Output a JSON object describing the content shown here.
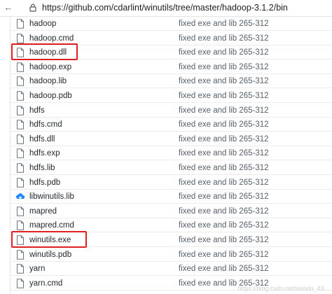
{
  "browser": {
    "url_host": "https://github.com",
    "url_path": "/cdarlint/winutils/tree/master/hadoop-3.1.2/bin"
  },
  "files": [
    {
      "name": "hadoop",
      "message": "fixed exe and lib 265-312",
      "icon": "file-icon",
      "highlighted": false
    },
    {
      "name": "hadoop.cmd",
      "message": "fixed exe and lib 265-312",
      "icon": "file-icon",
      "highlighted": false
    },
    {
      "name": "hadoop.dll",
      "message": "fixed exe and lib 265-312",
      "icon": "file-icon",
      "highlighted": true
    },
    {
      "name": "hadoop.exp",
      "message": "fixed exe and lib 265-312",
      "icon": "file-icon",
      "highlighted": false
    },
    {
      "name": "hadoop.lib",
      "message": "fixed exe and lib 265-312",
      "icon": "file-icon",
      "highlighted": false
    },
    {
      "name": "hadoop.pdb",
      "message": "fixed exe and lib 265-312",
      "icon": "file-icon",
      "highlighted": false
    },
    {
      "name": "hdfs",
      "message": "fixed exe and lib 265-312",
      "icon": "file-icon",
      "highlighted": false
    },
    {
      "name": "hdfs.cmd",
      "message": "fixed exe and lib 265-312",
      "icon": "file-icon",
      "highlighted": false
    },
    {
      "name": "hdfs.dll",
      "message": "fixed exe and lib 265-312",
      "icon": "file-icon",
      "highlighted": false
    },
    {
      "name": "hdfs.exp",
      "message": "fixed exe and lib 265-312",
      "icon": "file-icon",
      "highlighted": false
    },
    {
      "name": "hdfs.lib",
      "message": "fixed exe and lib 265-312",
      "icon": "file-icon",
      "highlighted": false
    },
    {
      "name": "hdfs.pdb",
      "message": "fixed exe and lib 265-312",
      "icon": "file-icon",
      "highlighted": false
    },
    {
      "name": "libwinutils.lib",
      "message": "fixed exe and lib 265-312",
      "icon": "upload-icon",
      "highlighted": false
    },
    {
      "name": "mapred",
      "message": "fixed exe and lib 265-312",
      "icon": "file-icon",
      "highlighted": false
    },
    {
      "name": "mapred.cmd",
      "message": "fixed exe and lib 265-312",
      "icon": "file-icon",
      "highlighted": false
    },
    {
      "name": "winutils.exe",
      "message": "fixed exe and lib 265-312",
      "icon": "file-icon",
      "highlighted": true
    },
    {
      "name": "winutils.pdb",
      "message": "fixed exe and lib 265-312",
      "icon": "file-icon",
      "highlighted": false
    },
    {
      "name": "yarn",
      "message": "fixed exe and lib 265-312",
      "icon": "file-icon",
      "highlighted": false
    },
    {
      "name": "yarn.cmd",
      "message": "fixed exe and lib 265-312",
      "icon": "file-icon",
      "highlighted": false
    }
  ],
  "colors": {
    "highlight_border": "#e02020",
    "link_text": "#24292e",
    "message_text": "#586069",
    "upload_icon": "#2188ff"
  },
  "watermark": "https://blog.csdn.net/weixin_43..."
}
